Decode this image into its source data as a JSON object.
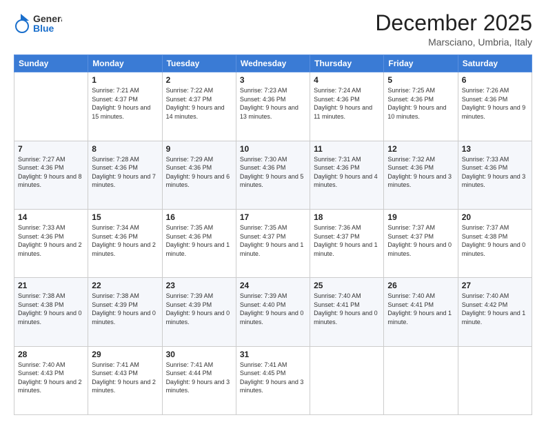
{
  "logo": {
    "line1": "General",
    "line2": "Blue"
  },
  "title": "December 2025",
  "location": "Marsciano, Umbria, Italy",
  "days_of_week": [
    "Sunday",
    "Monday",
    "Tuesday",
    "Wednesday",
    "Thursday",
    "Friday",
    "Saturday"
  ],
  "weeks": [
    [
      {
        "day": "",
        "sunrise": "",
        "sunset": "",
        "daylight": ""
      },
      {
        "day": "1",
        "sunrise": "Sunrise: 7:21 AM",
        "sunset": "Sunset: 4:37 PM",
        "daylight": "Daylight: 9 hours and 15 minutes."
      },
      {
        "day": "2",
        "sunrise": "Sunrise: 7:22 AM",
        "sunset": "Sunset: 4:37 PM",
        "daylight": "Daylight: 9 hours and 14 minutes."
      },
      {
        "day": "3",
        "sunrise": "Sunrise: 7:23 AM",
        "sunset": "Sunset: 4:36 PM",
        "daylight": "Daylight: 9 hours and 13 minutes."
      },
      {
        "day": "4",
        "sunrise": "Sunrise: 7:24 AM",
        "sunset": "Sunset: 4:36 PM",
        "daylight": "Daylight: 9 hours and 11 minutes."
      },
      {
        "day": "5",
        "sunrise": "Sunrise: 7:25 AM",
        "sunset": "Sunset: 4:36 PM",
        "daylight": "Daylight: 9 hours and 10 minutes."
      },
      {
        "day": "6",
        "sunrise": "Sunrise: 7:26 AM",
        "sunset": "Sunset: 4:36 PM",
        "daylight": "Daylight: 9 hours and 9 minutes."
      }
    ],
    [
      {
        "day": "7",
        "sunrise": "Sunrise: 7:27 AM",
        "sunset": "Sunset: 4:36 PM",
        "daylight": "Daylight: 9 hours and 8 minutes."
      },
      {
        "day": "8",
        "sunrise": "Sunrise: 7:28 AM",
        "sunset": "Sunset: 4:36 PM",
        "daylight": "Daylight: 9 hours and 7 minutes."
      },
      {
        "day": "9",
        "sunrise": "Sunrise: 7:29 AM",
        "sunset": "Sunset: 4:36 PM",
        "daylight": "Daylight: 9 hours and 6 minutes."
      },
      {
        "day": "10",
        "sunrise": "Sunrise: 7:30 AM",
        "sunset": "Sunset: 4:36 PM",
        "daylight": "Daylight: 9 hours and 5 minutes."
      },
      {
        "day": "11",
        "sunrise": "Sunrise: 7:31 AM",
        "sunset": "Sunset: 4:36 PM",
        "daylight": "Daylight: 9 hours and 4 minutes."
      },
      {
        "day": "12",
        "sunrise": "Sunrise: 7:32 AM",
        "sunset": "Sunset: 4:36 PM",
        "daylight": "Daylight: 9 hours and 3 minutes."
      },
      {
        "day": "13",
        "sunrise": "Sunrise: 7:33 AM",
        "sunset": "Sunset: 4:36 PM",
        "daylight": "Daylight: 9 hours and 3 minutes."
      }
    ],
    [
      {
        "day": "14",
        "sunrise": "Sunrise: 7:33 AM",
        "sunset": "Sunset: 4:36 PM",
        "daylight": "Daylight: 9 hours and 2 minutes."
      },
      {
        "day": "15",
        "sunrise": "Sunrise: 7:34 AM",
        "sunset": "Sunset: 4:36 PM",
        "daylight": "Daylight: 9 hours and 2 minutes."
      },
      {
        "day": "16",
        "sunrise": "Sunrise: 7:35 AM",
        "sunset": "Sunset: 4:36 PM",
        "daylight": "Daylight: 9 hours and 1 minute."
      },
      {
        "day": "17",
        "sunrise": "Sunrise: 7:35 AM",
        "sunset": "Sunset: 4:37 PM",
        "daylight": "Daylight: 9 hours and 1 minute."
      },
      {
        "day": "18",
        "sunrise": "Sunrise: 7:36 AM",
        "sunset": "Sunset: 4:37 PM",
        "daylight": "Daylight: 9 hours and 1 minute."
      },
      {
        "day": "19",
        "sunrise": "Sunrise: 7:37 AM",
        "sunset": "Sunset: 4:37 PM",
        "daylight": "Daylight: 9 hours and 0 minutes."
      },
      {
        "day": "20",
        "sunrise": "Sunrise: 7:37 AM",
        "sunset": "Sunset: 4:38 PM",
        "daylight": "Daylight: 9 hours and 0 minutes."
      }
    ],
    [
      {
        "day": "21",
        "sunrise": "Sunrise: 7:38 AM",
        "sunset": "Sunset: 4:38 PM",
        "daylight": "Daylight: 9 hours and 0 minutes."
      },
      {
        "day": "22",
        "sunrise": "Sunrise: 7:38 AM",
        "sunset": "Sunset: 4:39 PM",
        "daylight": "Daylight: 9 hours and 0 minutes."
      },
      {
        "day": "23",
        "sunrise": "Sunrise: 7:39 AM",
        "sunset": "Sunset: 4:39 PM",
        "daylight": "Daylight: 9 hours and 0 minutes."
      },
      {
        "day": "24",
        "sunrise": "Sunrise: 7:39 AM",
        "sunset": "Sunset: 4:40 PM",
        "daylight": "Daylight: 9 hours and 0 minutes."
      },
      {
        "day": "25",
        "sunrise": "Sunrise: 7:40 AM",
        "sunset": "Sunset: 4:41 PM",
        "daylight": "Daylight: 9 hours and 0 minutes."
      },
      {
        "day": "26",
        "sunrise": "Sunrise: 7:40 AM",
        "sunset": "Sunset: 4:41 PM",
        "daylight": "Daylight: 9 hours and 1 minute."
      },
      {
        "day": "27",
        "sunrise": "Sunrise: 7:40 AM",
        "sunset": "Sunset: 4:42 PM",
        "daylight": "Daylight: 9 hours and 1 minute."
      }
    ],
    [
      {
        "day": "28",
        "sunrise": "Sunrise: 7:40 AM",
        "sunset": "Sunset: 4:43 PM",
        "daylight": "Daylight: 9 hours and 2 minutes."
      },
      {
        "day": "29",
        "sunrise": "Sunrise: 7:41 AM",
        "sunset": "Sunset: 4:43 PM",
        "daylight": "Daylight: 9 hours and 2 minutes."
      },
      {
        "day": "30",
        "sunrise": "Sunrise: 7:41 AM",
        "sunset": "Sunset: 4:44 PM",
        "daylight": "Daylight: 9 hours and 3 minutes."
      },
      {
        "day": "31",
        "sunrise": "Sunrise: 7:41 AM",
        "sunset": "Sunset: 4:45 PM",
        "daylight": "Daylight: 9 hours and 3 minutes."
      },
      {
        "day": "",
        "sunrise": "",
        "sunset": "",
        "daylight": ""
      },
      {
        "day": "",
        "sunrise": "",
        "sunset": "",
        "daylight": ""
      },
      {
        "day": "",
        "sunrise": "",
        "sunset": "",
        "daylight": ""
      }
    ]
  ]
}
